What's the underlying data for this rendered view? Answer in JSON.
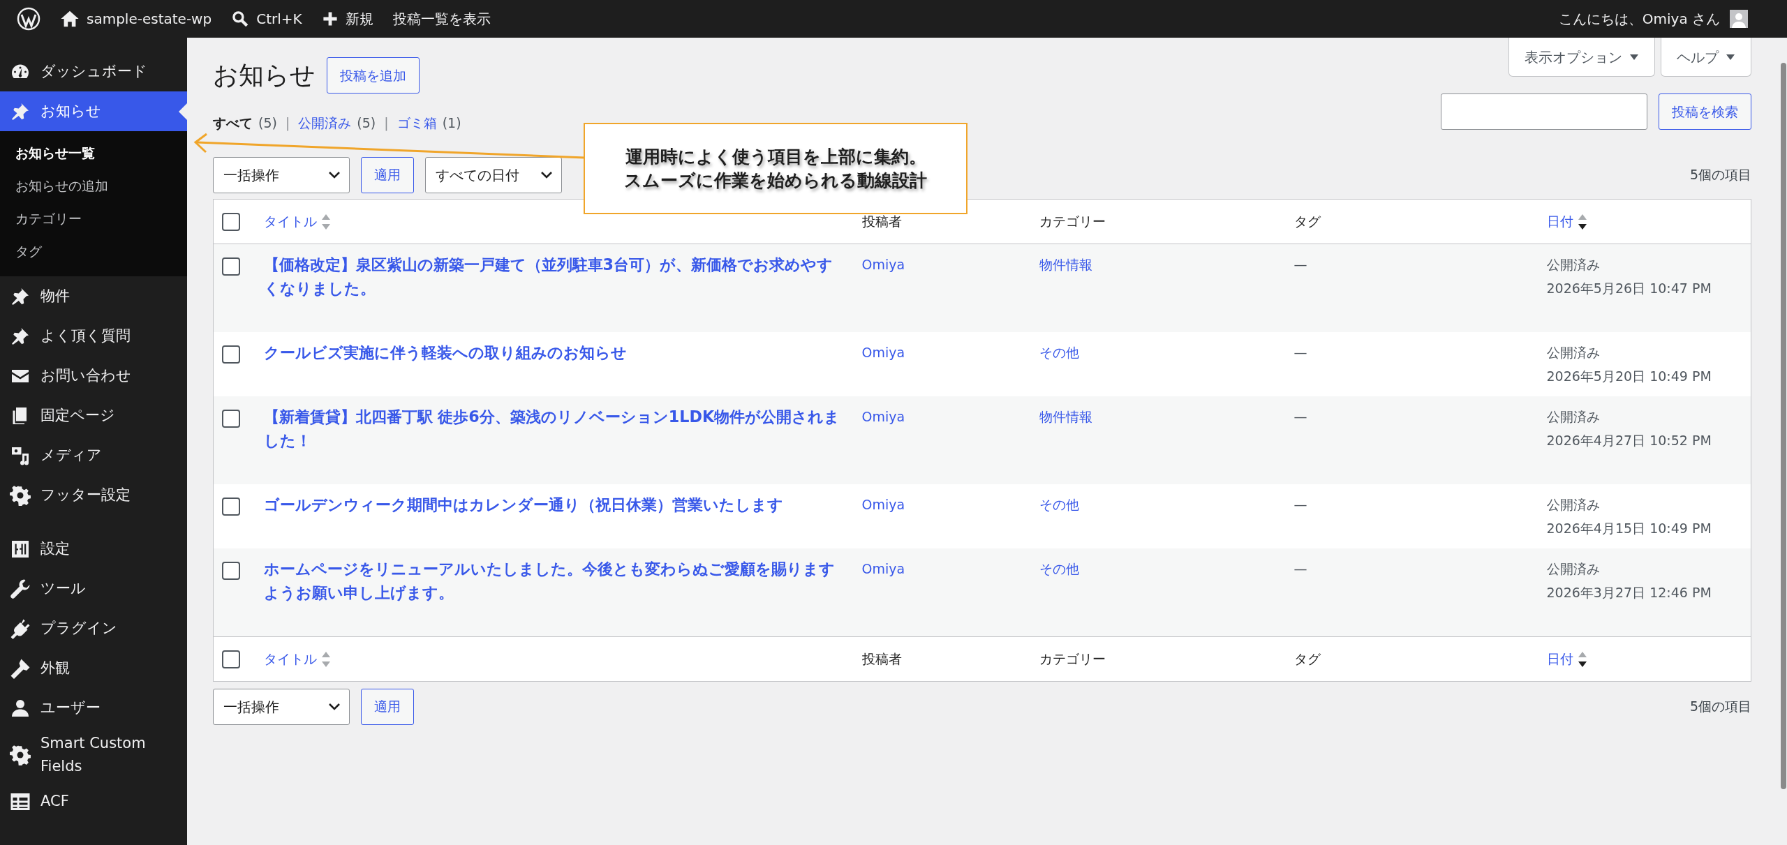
{
  "admin_bar": {
    "site": "sample-estate-wp",
    "search": "Ctrl+K",
    "new": "新規",
    "view": "投稿一覧を表示",
    "greeting": "こんにちは、Omiya さん"
  },
  "sidebar": {
    "groups": [
      [
        {
          "label": "ダッシュボード",
          "selected": false
        },
        {
          "label": "お知らせ",
          "selected": true,
          "children": [
            {
              "label": "お知らせ一覧",
              "selected": true
            },
            {
              "label": "お知らせの追加",
              "selected": false
            },
            {
              "label": "カテゴリー",
              "selected": false
            },
            {
              "label": "タグ",
              "selected": false
            }
          ]
        },
        {
          "label": "物件",
          "selected": false
        },
        {
          "label": "よく頂く質問",
          "selected": false
        },
        {
          "label": "お問い合わせ",
          "selected": false
        },
        {
          "label": "固定ページ",
          "selected": false
        },
        {
          "label": "メディア",
          "selected": false
        },
        {
          "label": "フッター設定",
          "selected": false
        }
      ],
      [
        {
          "label": "設定",
          "selected": false
        },
        {
          "label": "ツール",
          "selected": false
        },
        {
          "label": "プラグイン",
          "selected": false
        },
        {
          "label": "外観",
          "selected": false
        },
        {
          "label": "ユーザー",
          "selected": false
        },
        {
          "label": "Smart Custom Fields",
          "selected": false
        },
        {
          "label": "ACF",
          "selected": false
        }
      ]
    ]
  },
  "header": {
    "title": "お知らせ",
    "add_button": "投稿を追加",
    "screen_options": "表示オプション",
    "help": "ヘルプ"
  },
  "views": {
    "separator": "|",
    "items": [
      {
        "label": "すべて",
        "count": "(5)",
        "selected": true
      },
      {
        "label": "公開済み",
        "count": "(5)",
        "selected": false
      },
      {
        "label": "ゴミ箱",
        "count": "(1)",
        "selected": false
      }
    ]
  },
  "search": {
    "button": "投稿を検索"
  },
  "top_nav": {
    "bulk_action": "一括操作",
    "apply": "適用",
    "date_filter": "すべての日付",
    "count": "5個の項目"
  },
  "table": {
    "select_all_checked": false,
    "footer_select_all_checked": false,
    "columns": [
      {
        "label": "タイトル",
        "sorted": false
      },
      {
        "label": "投稿者"
      },
      {
        "label": "カテゴリー"
      },
      {
        "label": "タグ"
      },
      {
        "label": "日付",
        "sorted": true
      }
    ],
    "rows": [
      {
        "checked": false,
        "title": "【価格改定】泉区紫山の新築一戸建て（並列駐車3台可）が、新価格でお求めやすくなりました。",
        "author": "Omiya",
        "category": "物件情報",
        "tags": "—",
        "status": "公開済み",
        "date": "2026年5月26日 10:47 PM"
      },
      {
        "checked": false,
        "title": "クールビズ実施に伴う軽装への取り組みのお知らせ",
        "author": "Omiya",
        "category": "その他",
        "tags": "—",
        "status": "公開済み",
        "date": "2026年5月20日 10:49 PM"
      },
      {
        "checked": false,
        "title": "【新着賃貸】北四番丁駅 徒歩6分、築浅のリノベーション1LDK物件が公開されました！",
        "author": "Omiya",
        "category": "物件情報",
        "tags": "—",
        "status": "公開済み",
        "date": "2026年4月27日 10:52 PM"
      },
      {
        "checked": false,
        "title": "ゴールデンウィーク期間中はカレンダー通り（祝日休業）営業いたします",
        "author": "Omiya",
        "category": "その他",
        "tags": "—",
        "status": "公開済み",
        "date": "2026年4月15日 10:49 PM"
      },
      {
        "checked": false,
        "title": "ホームページをリニューアルいたしました。今後とも変わらぬご愛顧を賜りますようお願い申し上げます。",
        "author": "Omiya",
        "category": "その他",
        "tags": "—",
        "status": "公開済み",
        "date": "2026年3月27日 12:46 PM"
      }
    ],
    "footer_columns": [
      {
        "label": "タイトル",
        "sorted": false
      },
      {
        "label": "投稿者"
      },
      {
        "label": "カテゴリー"
      },
      {
        "label": "タグ"
      },
      {
        "label": "日付",
        "sorted": true
      }
    ]
  },
  "bottom_nav": {
    "bulk_action": "一括操作",
    "apply": "適用",
    "count": "5個の項目"
  },
  "callout": {
    "lines": [
      "運用時によく使う項目を上部に集約。",
      "スムーズに作業を始められる動線設計"
    ]
  }
}
